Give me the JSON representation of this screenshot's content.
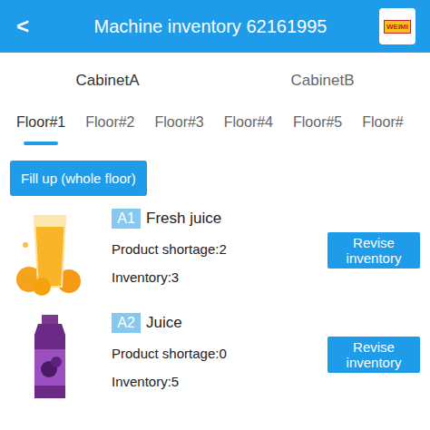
{
  "header": {
    "back": "<",
    "title": "Machine inventory 62161995",
    "logo": "WEIMI"
  },
  "cabinets": [
    {
      "label": "CabinetA",
      "selected": true
    },
    {
      "label": "CabinetB",
      "selected": false
    }
  ],
  "floors": [
    {
      "label": "Floor#1",
      "selected": true
    },
    {
      "label": "Floor#2",
      "selected": false
    },
    {
      "label": "Floor#3",
      "selected": false
    },
    {
      "label": "Floor#4",
      "selected": false
    },
    {
      "label": "Floor#5",
      "selected": false
    },
    {
      "label": "Floor#",
      "selected": false
    }
  ],
  "fill_button": "Fill up (whole floor)",
  "items": [
    {
      "slot": "A1",
      "name": "Fresh juice",
      "shortage": "Product shortage:2",
      "inventory": "Inventory:3",
      "button": "Revise inventory",
      "kind": "glass"
    },
    {
      "slot": "A2",
      "name": "Juice",
      "shortage": "Product shortage:0",
      "inventory": "Inventory:5",
      "button": "Revise inventory",
      "kind": "bottle"
    }
  ]
}
